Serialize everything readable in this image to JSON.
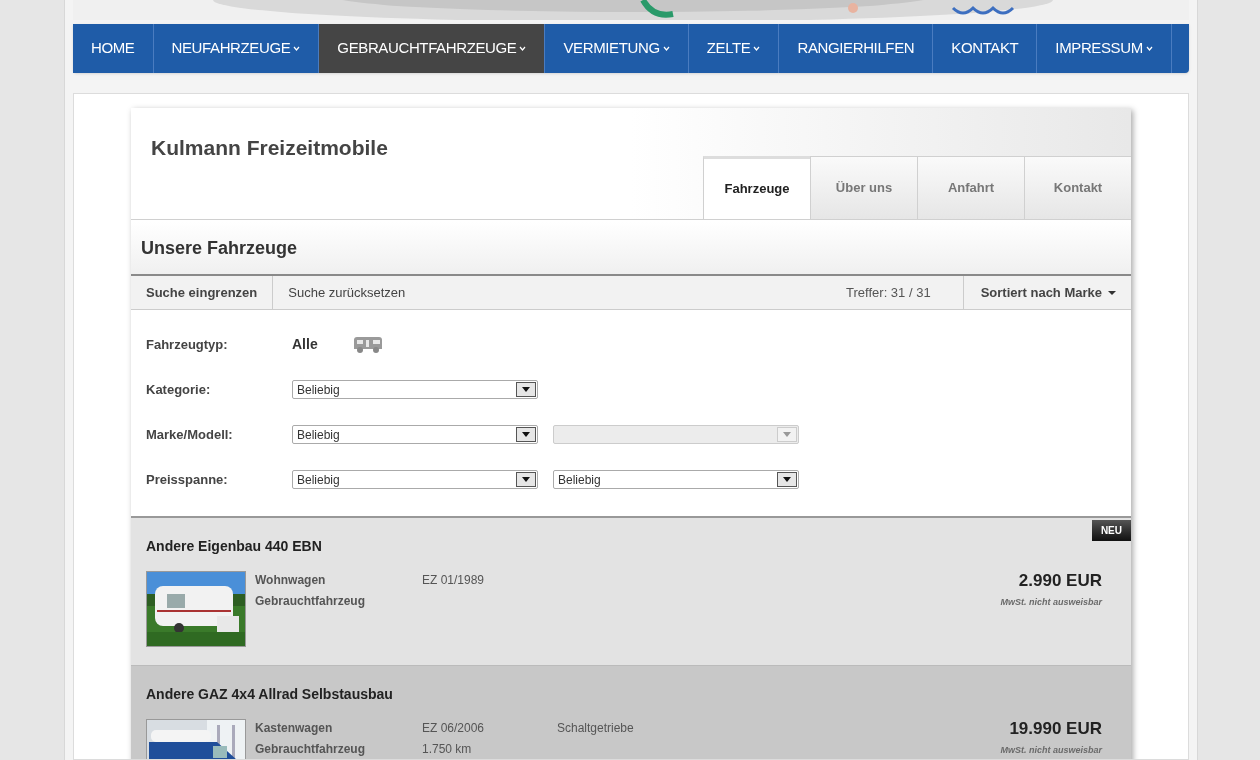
{
  "nav": [
    {
      "label": "HOME",
      "has_submenu": false,
      "selected": false
    },
    {
      "label": "NEUFAHRZEUGE",
      "has_submenu": true,
      "selected": false
    },
    {
      "label": "GEBRAUCHTFAHRZEUGE",
      "has_submenu": true,
      "selected": true
    },
    {
      "label": "VERMIETUNG",
      "has_submenu": true,
      "selected": false
    },
    {
      "label": "ZELTE",
      "has_submenu": true,
      "selected": false
    },
    {
      "label": "RANGIERHILFEN",
      "has_submenu": false,
      "selected": false
    },
    {
      "label": "KONTAKT",
      "has_submenu": false,
      "selected": false
    },
    {
      "label": "IMPRESSUM",
      "has_submenu": true,
      "selected": false
    }
  ],
  "dealer": {
    "title": "Kulmann Freizeitmobile",
    "tabs": [
      {
        "label": "Fahrzeuge",
        "selected": true
      },
      {
        "label": "Über uns",
        "selected": false
      },
      {
        "label": "Anfahrt",
        "selected": false
      },
      {
        "label": "Kontakt",
        "selected": false
      }
    ]
  },
  "section_title": "Unsere Fahrzeuge",
  "toolbar": {
    "refine": "Suche eingrenzen",
    "reset": "Suche zurücksetzen",
    "hits": "Treffer: 31 / 31",
    "sort": "Sortiert nach Marke"
  },
  "filters": [
    {
      "kind": "type",
      "label": "Fahrzeugtyp:",
      "value": "Alle"
    },
    {
      "kind": "selects",
      "label": "Kategorie:",
      "selects": [
        {
          "value": "Beliebig",
          "disabled": false
        }
      ]
    },
    {
      "kind": "selects",
      "label": "Marke/Modell:",
      "selects": [
        {
          "value": "Beliebig",
          "disabled": false
        },
        {
          "disabled": true
        }
      ]
    },
    {
      "kind": "selects",
      "label": "Preisspanne:",
      "selects": [
        {
          "value": "Beliebig",
          "disabled": false
        },
        {
          "value": "Beliebig",
          "disabled": false
        }
      ]
    }
  ],
  "listings": [
    {
      "title": "Andere Eigenbau 440 EBN",
      "badge": "NEU",
      "highlighted": false,
      "col_1": [
        "Wohnwagen",
        "Gebrauchtfahrzeug"
      ],
      "col_2": [
        "EZ 01/1989"
      ],
      "price": "2.990 EUR",
      "tax_note": "MwSt. nicht ausweisbar"
    },
    {
      "title": "Andere GAZ 4x4 Allrad Selbstausbau",
      "highlighted": true,
      "col_1": [
        "Kastenwagen",
        "Gebrauchtfahrzeug"
      ],
      "col_2": [
        "EZ 06/2006",
        "1.750 km"
      ],
      "col_3": [
        "Schaltgetriebe"
      ],
      "price": "19.990 EUR",
      "tax_note": "MwSt. nicht ausweisbar"
    }
  ]
}
